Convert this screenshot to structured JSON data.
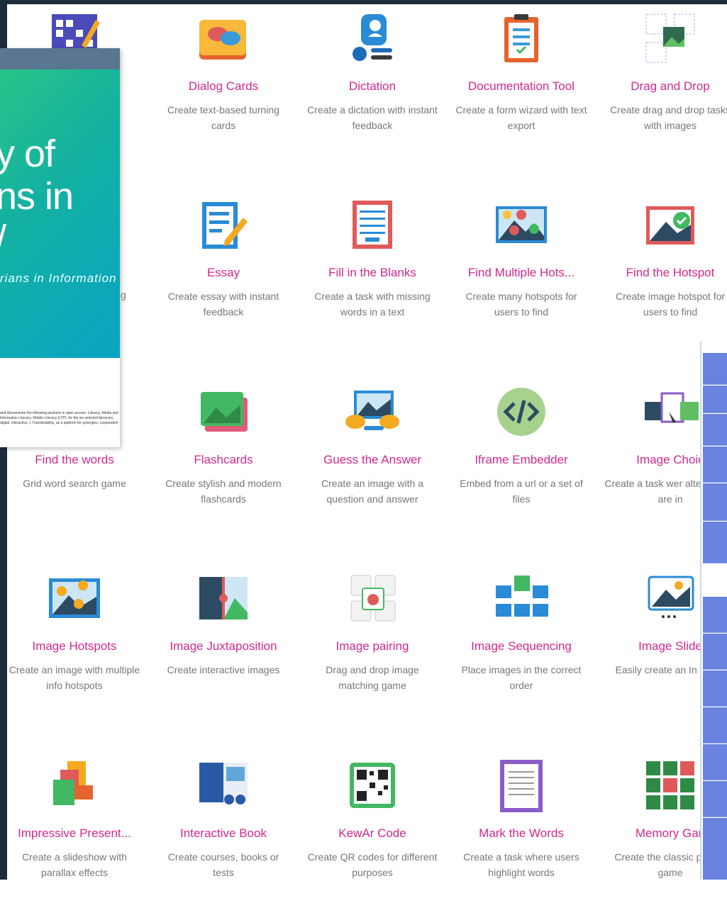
{
  "tiles": [
    {
      "name": "",
      "desc": "",
      "icon": "crossword-icon"
    },
    {
      "name": "Dialog Cards",
      "desc": "Create text-based turning cards",
      "icon": "dialog-cards-icon"
    },
    {
      "name": "Dictation",
      "desc": "Create a dictation with instant feedback",
      "icon": "dictation-icon"
    },
    {
      "name": "Documentation Tool",
      "desc": "Create a form wizard with text export",
      "icon": "documentation-tool-icon"
    },
    {
      "name": "Drag and Drop",
      "desc": "Create drag and drop tasks with images",
      "icon": "drag-and-drop-icon"
    },
    {
      "name": "",
      "desc": "",
      "icon": ""
    },
    {
      "name": "Essay",
      "desc": "Create essay with instant feedback",
      "icon": "essay-icon"
    },
    {
      "name": "Fill in the Blanks",
      "desc": "Create a task with missing words in a text",
      "icon": "fill-blanks-icon"
    },
    {
      "name": "Find Multiple Hots...",
      "desc": "Create many hotspots for users to find",
      "icon": "find-multiple-hotspots-icon"
    },
    {
      "name": "Find the Hotspot",
      "desc": "Create image hotspot for users to find",
      "icon": "find-hotspot-icon"
    },
    {
      "name": "Find the words",
      "desc": "Grid word search game",
      "icon": "find-words-icon"
    },
    {
      "name": "Flashcards",
      "desc": "Create stylish and modern flashcards",
      "icon": "flashcards-icon"
    },
    {
      "name": "Guess the Answer",
      "desc": "Create an image with a question and answer",
      "icon": "guess-answer-icon"
    },
    {
      "name": "Iframe Embedder",
      "desc": "Embed from a url or a set of files",
      "icon": "code-icon"
    },
    {
      "name": "Image Choic",
      "desc": "Create a task wer alternatives are in",
      "icon": "image-choice-icon"
    },
    {
      "name": "Image Hotspots",
      "desc": "Create an image with multiple info hotspots",
      "icon": "image-hotspots-icon"
    },
    {
      "name": "Image Juxtaposition",
      "desc": "Create interactive images",
      "icon": "image-juxtaposition-icon"
    },
    {
      "name": "Image pairing",
      "desc": "Drag and drop image matching game",
      "icon": "image-pairing-icon"
    },
    {
      "name": "Image Sequencing",
      "desc": "Place images in the correct order",
      "icon": "image-sequencing-icon"
    },
    {
      "name": "Image Slide",
      "desc": "Easily create an In Slider",
      "icon": "image-slider-icon"
    },
    {
      "name": "Impressive Present...",
      "desc": "Create a slideshow with parallax effects",
      "icon": "presentation-icon"
    },
    {
      "name": "Interactive Book",
      "desc": "Create courses, books or tests",
      "icon": "interactive-book-icon"
    },
    {
      "name": "KewAr Code",
      "desc": "Create QR codes for different purposes",
      "icon": "qr-code-icon"
    },
    {
      "name": "Mark the Words",
      "desc": "Create a task where users highlight words",
      "icon": "mark-words-icon"
    },
    {
      "name": "Memory Gan",
      "desc": "Create the classic pairing game",
      "icon": "memory-game-icon"
    }
  ],
  "slide": {
    "line1": "y of",
    "line2": "ns in",
    "line3": "/",
    "subtitle": "rians in Information",
    "fine": "and disseminate the following products in open access: Literacy, Media and Information Literacy, Mobile Literacy (LTP), for the six selected literacies, digital, interactive, c Transferability, as a platform for synergies, cooperation",
    "edge_text": "g"
  },
  "colors": {
    "accent": "#d1288f",
    "desc": "#777777",
    "frame": "#1e2b38",
    "table": "#6a83e0"
  }
}
